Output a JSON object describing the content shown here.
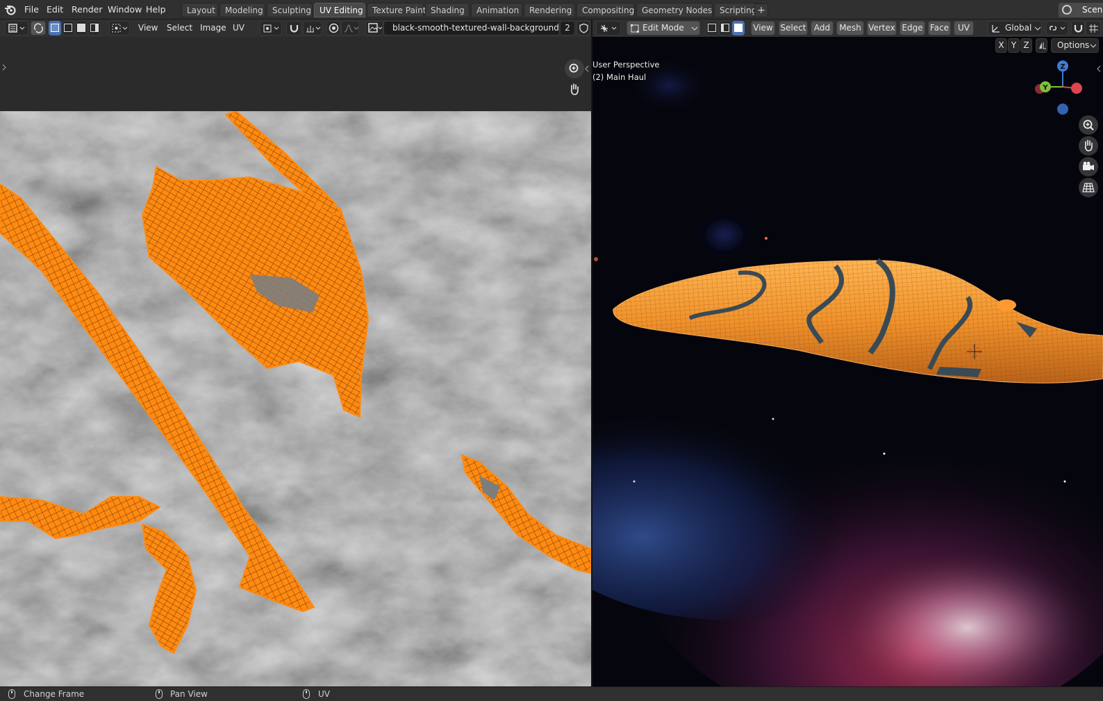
{
  "app": {
    "menus": [
      "File",
      "Edit",
      "Render",
      "Window",
      "Help"
    ],
    "workspaces": [
      "Layout",
      "Modeling",
      "Sculpting",
      "UV Editing",
      "Texture Paint",
      "Shading",
      "Animation",
      "Rendering",
      "Compositing",
      "Geometry Nodes",
      "Scripting"
    ],
    "active_workspace": "UV Editing",
    "add_workspace": "+",
    "scene_label": "Scen"
  },
  "uv_editor": {
    "menus": [
      "View",
      "Select",
      "Image",
      "UV"
    ],
    "image_name": "black-smooth-textured-wall-background.jpg",
    "image_users": "2"
  },
  "viewport": {
    "mode": "Edit Mode",
    "menus": [
      "View",
      "Select",
      "Add",
      "Mesh",
      "Vertex",
      "Edge",
      "Face",
      "UV"
    ],
    "transform_orientation": "Global",
    "axes": [
      "X",
      "Y",
      "Z"
    ],
    "options_label": "Options",
    "overlay_line1": "User Perspective",
    "overlay_line2": "(2) Main Haul",
    "gizmo_labels": {
      "z": "Z",
      "y": "Y"
    }
  },
  "status_bar": {
    "left_action": "Change Frame",
    "middle_action": "Pan View",
    "right_action": "UV"
  },
  "colors": {
    "uv_selection": "#ff8a12",
    "active_tab": "#4a4a4a",
    "selected_button": "#4772b3",
    "axis_x": "#e04450",
    "axis_y": "#7fbf3a",
    "axis_z": "#3e7ad9"
  }
}
